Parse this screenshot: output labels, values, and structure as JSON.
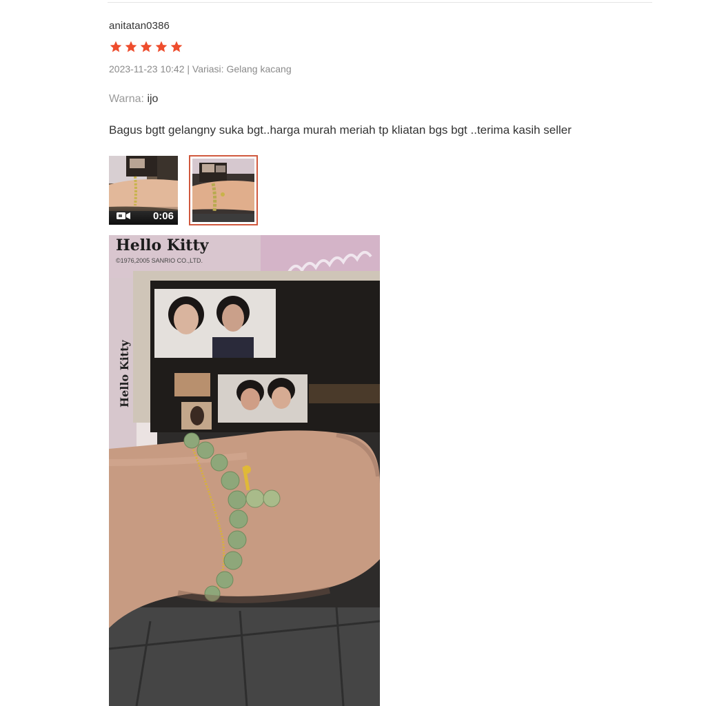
{
  "review": {
    "username": "anitatan0386",
    "rating": 5,
    "rating_max": 5,
    "meta": "2023-11-23 10:42 | Variasi: Gelang kacang",
    "warna_label": "Warna:",
    "warna_value": "ijo",
    "comment": "Bagus bgtt gelangny suka bgt..harga murah meriah tp kliatan bgs bgt ..terima kasih seller",
    "media": [
      {
        "type": "video",
        "duration": "0:06",
        "selected": false
      },
      {
        "type": "image",
        "selected": true
      }
    ],
    "photo_text": {
      "brand": "Hello Kitty",
      "copyright": "©1976,2005 SANRIO CO.,LTD."
    }
  },
  "colors": {
    "star": "#ee4d2d",
    "selected_border": "#d0583d",
    "text": "#333333",
    "muted": "#8a8a8a"
  },
  "icons": {
    "star": "star-icon",
    "video": "video-camera-icon"
  }
}
